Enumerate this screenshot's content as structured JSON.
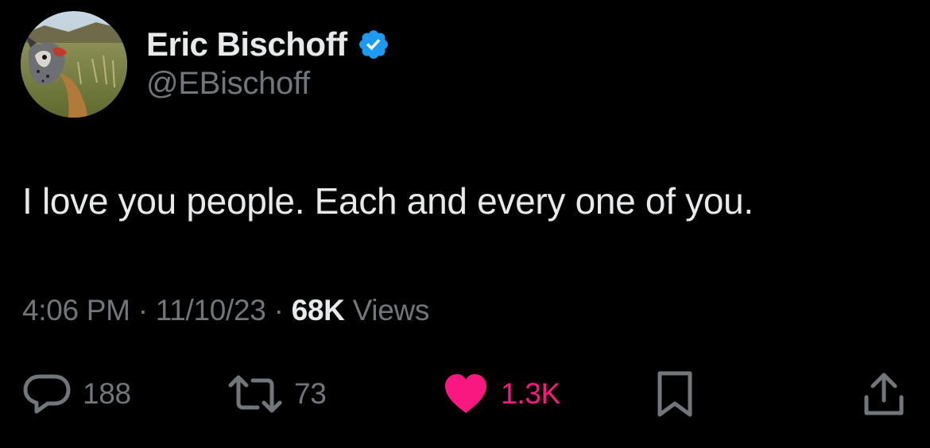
{
  "user": {
    "display_name": "Eric Bischoff",
    "handle": "@EBischoff",
    "verified": true
  },
  "tweet": {
    "text": "I love you people. Each and every one of you.",
    "time": "4:06 PM",
    "date": "11/10/23",
    "separator": "·",
    "views_count": "68K",
    "views_label": "Views"
  },
  "actions": {
    "replies": "188",
    "retweets": "73",
    "likes": "1.3K"
  },
  "colors": {
    "background": "#000000",
    "primary_text": "#e7e9ea",
    "secondary_text": "#71767b",
    "verified_blue": "#1d9bf0",
    "like_pink": "#f91880"
  },
  "icons": {
    "verified": "verified-badge-icon",
    "reply": "speech-bubble-icon",
    "retweet": "retweet-arrows-icon",
    "like": "heart-icon",
    "bookmark": "bookmark-icon",
    "share": "share-upload-icon"
  }
}
